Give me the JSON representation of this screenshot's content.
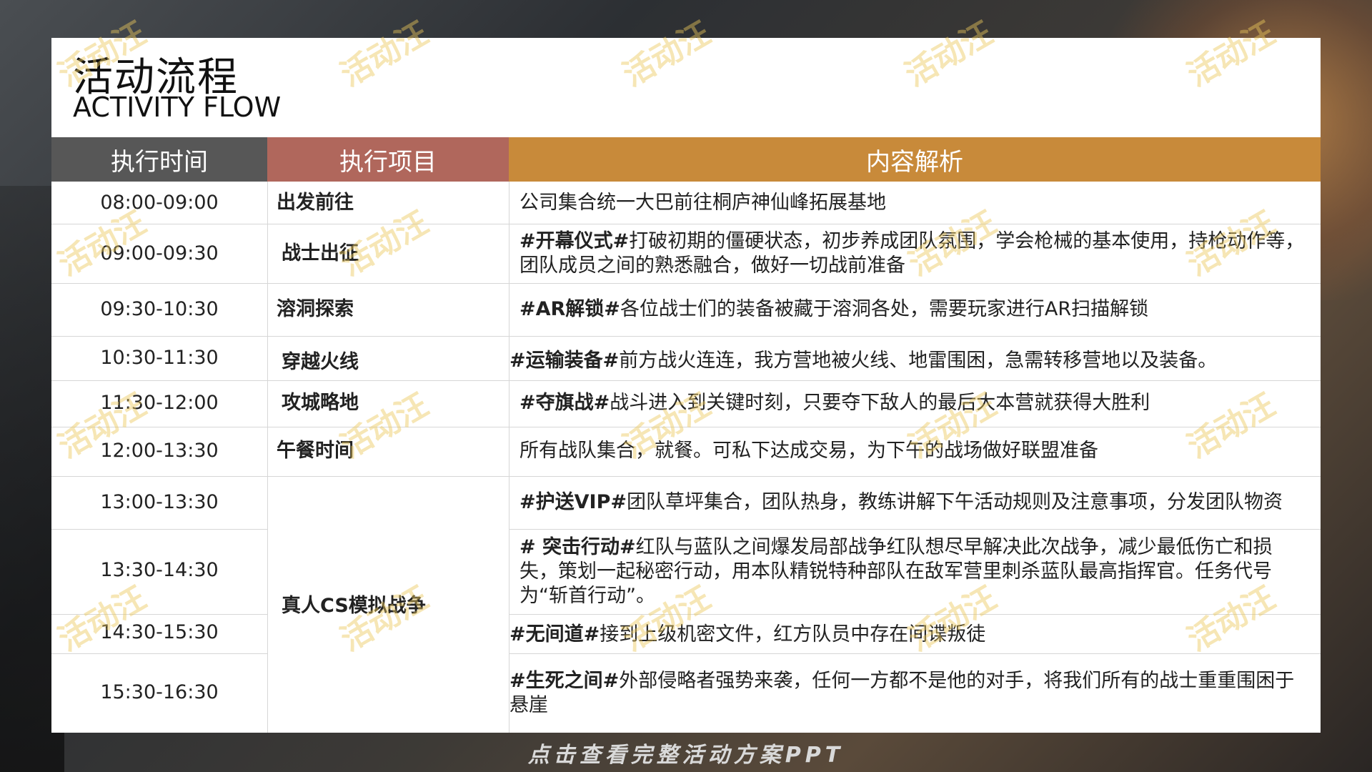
{
  "title": {
    "cn": "活动流程",
    "en": "ACTIVITY FLOW"
  },
  "headers": {
    "time": "执行时间",
    "item": "执行项目",
    "desc": "内容解析"
  },
  "rows": [
    {
      "time": "08:00-09:00",
      "item": "出发前往",
      "tag": "",
      "desc": "公司集合统一大巴前往桐庐神仙峰拓展基地"
    },
    {
      "time": "09:00-09:30",
      "item": "战士出征",
      "tag": "#开幕仪式#",
      "desc": "打破初期的僵硬状态，初步养成团队氛围，学会枪械的基本使用，持枪动作等，团队成员之间的熟悉融合，做好一切战前准备"
    },
    {
      "time": "09:30-10:30",
      "item": "溶洞探索",
      "tag": "#AR解锁#",
      "desc": "各位战士们的装备被藏于溶洞各处，需要玩家进行AR扫描解锁"
    },
    {
      "time": "10:30-11:30",
      "item": "穿越火线",
      "tag": "#运输装备#",
      "desc": "前方战火连连，我方营地被火线、地雷围困，急需转移营地以及装备。"
    },
    {
      "time": "11:30-12:00",
      "item": "攻城略地",
      "tag": "#夺旗战#",
      "desc": "战斗进入到关键时刻，只要夺下敌人的最后大本营就获得大胜利"
    },
    {
      "time": "12:00-13:30",
      "item": "午餐时间",
      "tag": "",
      "desc": "所有战队集合，就餐。可私下达成交易，为下午的战场做好联盟准备"
    },
    {
      "time": "13:00-13:30",
      "item": "",
      "tag": "#护送VIP#",
      "desc": "团队草坪集合，团队热身，教练讲解下午活动规则及注意事项，分发团队物资"
    },
    {
      "time": "13:30-14:30",
      "item": "",
      "tag": "# 突击行动#",
      "desc": "红队与蓝队之间爆发局部战争红队想尽早解决此次战争，减少最低伤亡和损失，策划一起秘密行动，用本队精锐特种部队在敌军营里刺杀蓝队最高指挥官。任务代号为“斩首行动”。"
    },
    {
      "time": "14:30-15:30",
      "item": "",
      "tag": "#无间道#",
      "desc": "接到上级机密文件，红方队员中存在间谍叛徒"
    },
    {
      "time": "15:30-16:30",
      "item": "",
      "tag": "#生死之间#",
      "desc": "外部侵略者强势来袭，任何一方都不是他的对手，将我们所有的战士重重围困于悬崖"
    }
  ],
  "merged_item": "真人CS模拟战争",
  "footer": "点击查看完整活动方案PPT",
  "watermark": "活动汪",
  "colors": {
    "header_time": "#575757",
    "header_item": "#b0675c",
    "header_desc": "#c88a3a"
  }
}
